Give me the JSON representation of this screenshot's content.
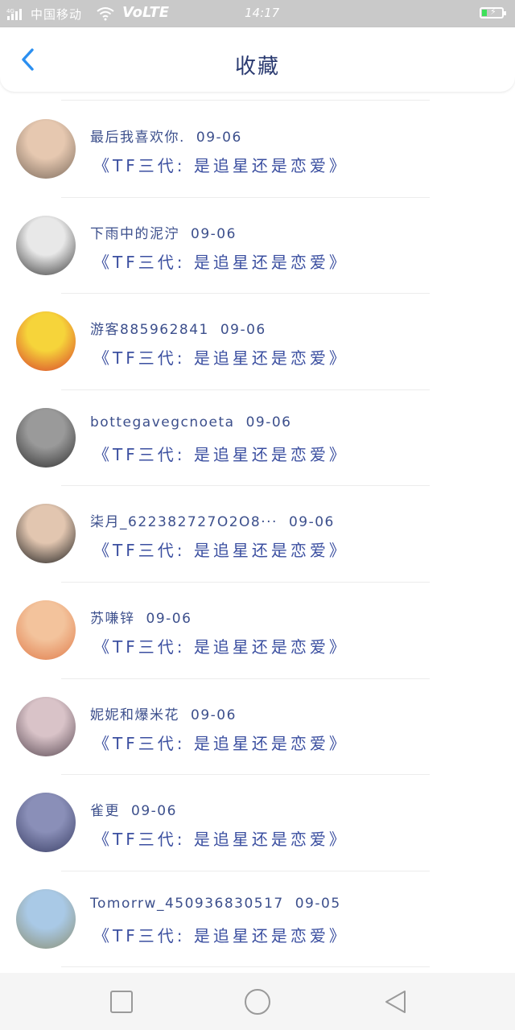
{
  "status_bar": {
    "signal_label": "4G",
    "carrier": "中国移动",
    "network": "VoLTE",
    "time": "14:17",
    "battery_level": 0.25
  },
  "header": {
    "title": "收藏",
    "back_icon": "chevron-left-icon"
  },
  "colors": {
    "accent": "#2b8ff0",
    "title": "#2a3a70",
    "meta_text": "#3c4f8c",
    "book_text": "#3b4fa0",
    "status_bar_bg": "#c9c9c9",
    "nav_bar_bg": "#f5f5f5"
  },
  "favorites": [
    {
      "user": "最后我喜欢你.",
      "date": "09-06",
      "book": "《TF三代: 是追星还是恋爱》",
      "avatar_colors": [
        "#e6c8b0",
        "#7b6a5c"
      ]
    },
    {
      "user": "下雨中的泥泞",
      "date": "09-06",
      "book": "《TF三代: 是追星还是恋爱》",
      "avatar_colors": [
        "#e8e8e8",
        "#3b3b3b"
      ]
    },
    {
      "user": "游客885962841",
      "date": "09-06",
      "book": "《TF三代: 是追星还是恋爱》",
      "avatar_colors": [
        "#f6d43a",
        "#d8412c"
      ]
    },
    {
      "user": "bottegavegcnoeta",
      "date": "09-06",
      "book": "《TF三代: 是追星还是恋爱》",
      "avatar_colors": [
        "#9a9a9a",
        "#2f2f2f"
      ]
    },
    {
      "user": "柒月_622382727O2O8···",
      "date": "09-06",
      "book": "《TF三代: 是追星还是恋爱》",
      "avatar_colors": [
        "#e2c6b0",
        "#1f1f1f"
      ]
    },
    {
      "user": "苏嗛锌",
      "date": "09-06",
      "book": "《TF三代: 是追星还是恋爱》",
      "avatar_colors": [
        "#f3c39c",
        "#e07b4a"
      ]
    },
    {
      "user": "妮妮和爆米花",
      "date": "09-06",
      "book": "《TF三代: 是追星还是恋爱》",
      "avatar_colors": [
        "#d9c3c8",
        "#5a4a54"
      ]
    },
    {
      "user": "雀更",
      "date": "09-06",
      "book": "《TF三代: 是追星还是恋爱》",
      "avatar_colors": [
        "#8a8fb8",
        "#3a3f66"
      ]
    },
    {
      "user": "Tomorrw_450936830517",
      "date": "09-05",
      "book": "《TF三代: 是追星还是恋爱》",
      "avatar_colors": [
        "#a9c9e6",
        "#8b8f73"
      ]
    }
  ],
  "nav_bar": {
    "recent_icon": "square-icon",
    "home_icon": "circle-icon",
    "back_icon": "triangle-back-icon"
  }
}
